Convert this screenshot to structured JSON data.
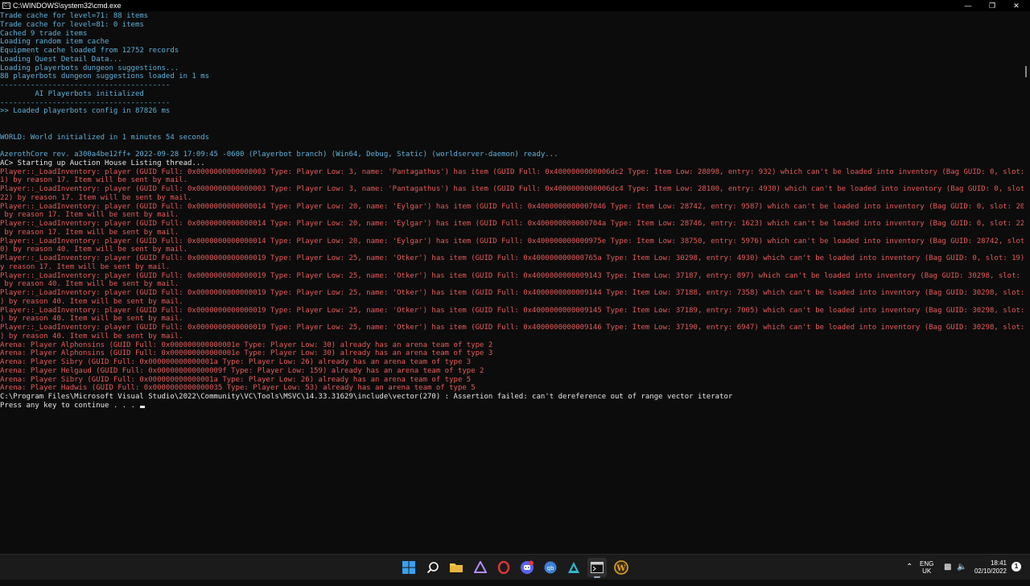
{
  "window": {
    "title": "C:\\WINDOWS\\system32\\cmd.exe",
    "minimize_icon": "minimize-icon",
    "maximize_icon": "restore-icon",
    "close_icon": "close-icon"
  },
  "console": {
    "lines": [
      {
        "color": "cyan",
        "text": "Trade cache for level=71: 88 items"
      },
      {
        "color": "cyan",
        "text": "Trade cache for level=81: 0 items"
      },
      {
        "color": "cyan",
        "text": "Cached 9 trade items"
      },
      {
        "color": "cyan",
        "text": "Loading random item cache"
      },
      {
        "color": "cyan",
        "text": "Equipment cache loaded from 12752 records"
      },
      {
        "color": "cyan",
        "text": "Loading Quest Detail Data..."
      },
      {
        "color": "cyan",
        "text": "Loading playerbots dungeon suggestions..."
      },
      {
        "color": "cyan",
        "text": "88 playerbots dungeon suggestions loaded in 1 ms"
      },
      {
        "color": "cyan",
        "text": "---------------------------------------"
      },
      {
        "color": "cyan",
        "text": "        AI Playerbots initialized"
      },
      {
        "color": "cyan",
        "text": "---------------------------------------"
      },
      {
        "color": "cyan",
        "text": ">> Loaded playerbots config in 87826 ms"
      },
      {
        "color": "blank",
        "text": ""
      },
      {
        "color": "blank",
        "text": ""
      },
      {
        "color": "cyan",
        "text": "WORLD: World initialized in 1 minutes 54 seconds"
      },
      {
        "color": "blank",
        "text": ""
      },
      {
        "color": "cyan",
        "text": "AzerothCore rev. a300a4be12ff+ 2022-09-28 17:09:45 -0600 (Playerbot branch) (Win64, Debug, Static) (worldserver-daemon) ready..."
      },
      {
        "color": "white",
        "text": "AC> Starting up Auction House Listing thread..."
      },
      {
        "color": "red",
        "text": "Player::_LoadInventory: player (GUID Full: 0x0000000000000003 Type: Player Low: 3, name: 'Pantagathus') has item (GUID Full: 0x4000000000006dc2 Type: Item Low: 28098, entry: 932) which can't be loaded into inventory (Bag GUID: 0, slot: 2"
      },
      {
        "color": "red",
        "text": "1) by reason 17. Item will be sent by mail."
      },
      {
        "color": "red",
        "text": "Player::_LoadInventory: player (GUID Full: 0x0000000000000003 Type: Player Low: 3, name: 'Pantagathus') has item (GUID Full: 0x4000000000006dc4 Type: Item Low: 28100, entry: 4930) which can't be loaded into inventory (Bag GUID: 0, slot:"
      },
      {
        "color": "red",
        "text": "22) by reason 17. Item will be sent by mail."
      },
      {
        "color": "red",
        "text": "Player::_LoadInventory: player (GUID Full: 0x0000000000000014 Type: Player Low: 20, name: 'Eylgar') has item (GUID Full: 0x4000000000007046 Type: Item Low: 28742, entry: 9587) which can't be loaded into inventory (Bag GUID: 0, slot: 20)"
      },
      {
        "color": "red",
        "text": " by reason 17. Item will be sent by mail."
      },
      {
        "color": "red",
        "text": "Player::_LoadInventory: player (GUID Full: 0x0000000000000014 Type: Player Low: 20, name: 'Eylgar') has item (GUID Full: 0x400000000000704a Type: Item Low: 28746, entry: 1623) which can't be loaded into inventory (Bag GUID: 0, slot: 22)"
      },
      {
        "color": "red",
        "text": " by reason 17. Item will be sent by mail."
      },
      {
        "color": "red",
        "text": "Player::_LoadInventory: player (GUID Full: 0x0000000000000014 Type: Player Low: 20, name: 'Eylgar') has item (GUID Full: 0x400000000000975e Type: Item Low: 38750, entry: 5976) which can't be loaded into inventory (Bag GUID: 28742, slot:"
      },
      {
        "color": "red",
        "text": "0) by reason 40. Item will be sent by mail."
      },
      {
        "color": "red",
        "text": "Player::_LoadInventory: player (GUID Full: 0x0000000000000019 Type: Player Low: 25, name: 'Otker') has item (GUID Full: 0x400000000000765a Type: Item Low: 30298, entry: 4930) which can't be loaded into inventory (Bag GUID: 0, slot: 19) b"
      },
      {
        "color": "red",
        "text": "y reason 17. Item will be sent by mail."
      },
      {
        "color": "red",
        "text": "Player::_LoadInventory: player (GUID Full: 0x0000000000000019 Type: Player Low: 25, name: 'Otker') has item (GUID Full: 0x4000000000009143 Type: Item Low: 37187, entry: 897) which can't be loaded into inventory (Bag GUID: 30298, slot: 0)"
      },
      {
        "color": "red",
        "text": " by reason 40. Item will be sent by mail."
      },
      {
        "color": "red",
        "text": "Player::_LoadInventory: player (GUID Full: 0x0000000000000019 Type: Player Low: 25, name: 'Otker') has item (GUID Full: 0x4000000000009144 Type: Item Low: 37188, entry: 7358) which can't be loaded into inventory (Bag GUID: 30298, slot: 1"
      },
      {
        "color": "red",
        "text": ") by reason 40. Item will be sent by mail."
      },
      {
        "color": "red",
        "text": "Player::_LoadInventory: player (GUID Full: 0x0000000000000019 Type: Player Low: 25, name: 'Otker') has item (GUID Full: 0x4000000000009145 Type: Item Low: 37189, entry: 7005) which can't be loaded into inventory (Bag GUID: 30298, slot: 2"
      },
      {
        "color": "red",
        "text": ") by reason 40. Item will be sent by mail."
      },
      {
        "color": "red",
        "text": "Player::_LoadInventory: player (GUID Full: 0x0000000000000019 Type: Player Low: 25, name: 'Otker') has item (GUID Full: 0x4000000000009146 Type: Item Low: 37190, entry: 6947) which can't be loaded into inventory (Bag GUID: 30298, slot: 3"
      },
      {
        "color": "red",
        "text": ") by reason 40. Item will be sent by mail."
      },
      {
        "color": "red",
        "text": "Arena: Player Alphonsins (GUID Full: 0x000000000000001e Type: Player Low: 30) already has an arena team of type 2"
      },
      {
        "color": "red",
        "text": "Arena: Player Alphonsins (GUID Full: 0x000000000000001e Type: Player Low: 30) already has an arena team of type 3"
      },
      {
        "color": "red",
        "text": "Arena: Player Sibry (GUID Full: 0x000000000000001a Type: Player Low: 26) already has an arena team of type 3"
      },
      {
        "color": "red",
        "text": "Arena: Player Helgaud (GUID Full: 0x000000000000009f Type: Player Low: 159) already has an arena team of type 2"
      },
      {
        "color": "red",
        "text": "Arena: Player Sibry (GUID Full: 0x000000000000001a Type: Player Low: 26) already has an arena team of type 5"
      },
      {
        "color": "red",
        "text": "Arena: Player Hadwis (GUID Full: 0x0000000000000035 Type: Player Low: 53) already has an arena team of type 5"
      },
      {
        "color": "white",
        "text": "C:\\Program Files\\Microsoft Visual Studio\\2022\\Community\\VC\\Tools\\MSVC\\14.33.31629\\include\\vector(270) : Assertion failed: can't dereference out of range vector iterator"
      },
      {
        "color": "white",
        "text": "Press any key to continue . . . ",
        "cursor": true
      }
    ]
  },
  "taskbar": {
    "apps": [
      {
        "name": "start-button",
        "icon": "windows-logo-icon",
        "color": "#3aa0f0"
      },
      {
        "name": "search-button",
        "icon": "search-icon",
        "color": "#ffffff"
      },
      {
        "name": "file-explorer-button",
        "icon": "folder-icon",
        "color": "#f2c94c"
      },
      {
        "name": "app-triangle-button",
        "icon": "triangle-app-icon",
        "color": "#b38cff"
      },
      {
        "name": "opera-button",
        "icon": "opera-icon",
        "color": "#e3353b"
      },
      {
        "name": "discord-button",
        "icon": "discord-icon",
        "color": "#5865f2"
      },
      {
        "name": "qbittorrent-button",
        "icon": "qbittorrent-icon",
        "color": "#3b82d6"
      },
      {
        "name": "app-teal-button",
        "icon": "teal-triangle-icon",
        "color": "#2fb6c9"
      },
      {
        "name": "cmd-button",
        "icon": "terminal-icon",
        "color": "#cfcfcf",
        "active": true
      },
      {
        "name": "wow-button",
        "icon": "wow-logo-icon",
        "color": "#e0a526"
      }
    ],
    "tray": {
      "chevron_icon": "chevron-up-icon",
      "lang_line1": "ENG",
      "lang_line2": "UK",
      "network_icon": "network-icon",
      "volume_icon": "volume-icon",
      "time": "18:41",
      "date": "02/10/2022",
      "notification_count": "1"
    }
  }
}
